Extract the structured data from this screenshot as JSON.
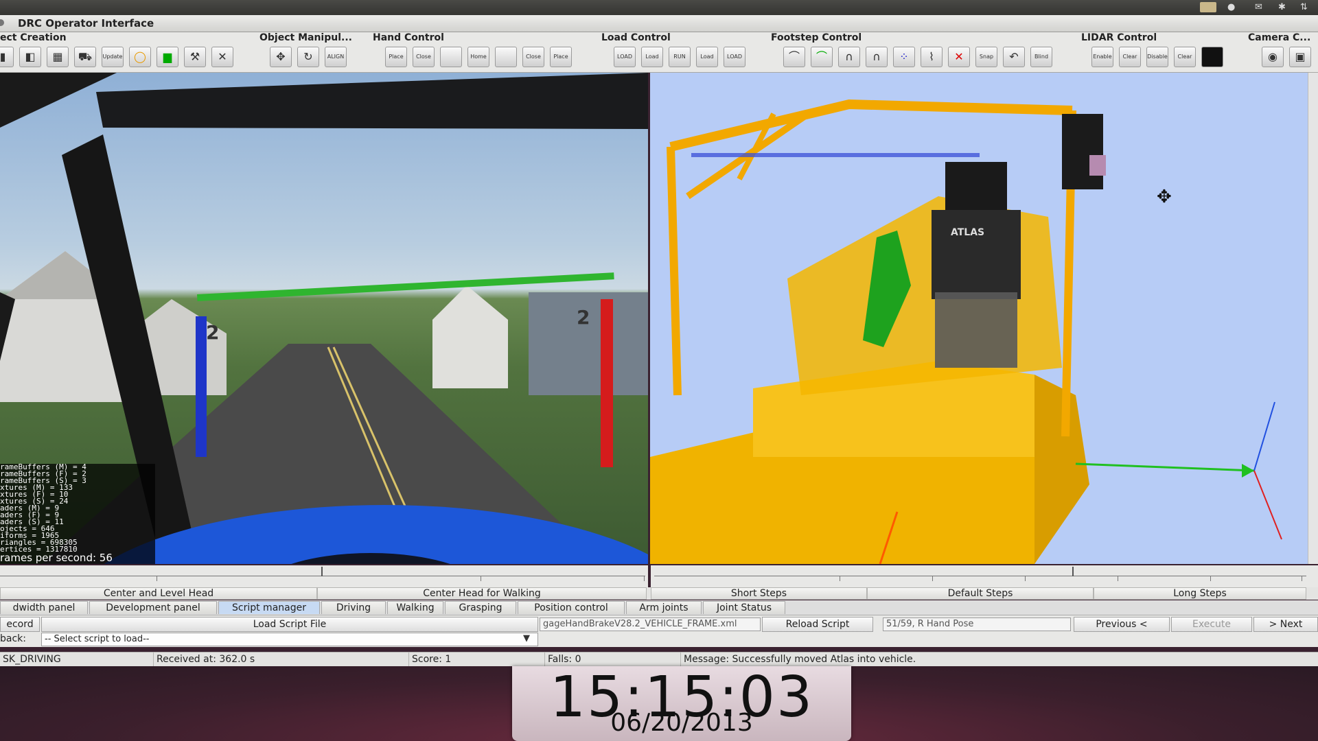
{
  "window": {
    "title": "DRC Operator Interface"
  },
  "toolbar": {
    "groups": [
      {
        "title": "ect Creation"
      },
      {
        "title": "Object Manipul..."
      },
      {
        "title": "Hand Control"
      },
      {
        "title": "Load Control"
      },
      {
        "title": "Footstep Control"
      },
      {
        "title": "LIDAR Control"
      },
      {
        "title": "Camera C..."
      }
    ],
    "icon_labels": {
      "align": "ALIGN",
      "place": "Place",
      "close": "Close",
      "home": "Home",
      "load": "LOAD",
      "load2": "Load",
      "run": "RUN",
      "snap": "Snap",
      "blind": "Blind",
      "enable": "Enable",
      "clear": "Clear",
      "disable": "Disable",
      "update": "Update"
    }
  },
  "left_view": {
    "sign_numbers": [
      "2",
      "2"
    ],
    "stats": [
      "rameBuffers (M) = 4",
      "rameBuffers (F) = 2",
      "rameBuffers (S) = 3",
      "xtures (M) = 133",
      "xtures (F) = 10",
      "xtures (S) = 24",
      "aders (M) = 9",
      "aders (F) = 9",
      "aders (S) = 11",
      "ojects = 646",
      "iforms = 1965",
      "riangles = 698305",
      "ertices = 1317810"
    ],
    "fps": "rames per second: 56"
  },
  "right_view": {
    "robot_label": "ATLAS"
  },
  "head_buttons": {
    "center_level": "Center and Level Head",
    "center_walking": "Center Head for Walking"
  },
  "step_buttons": {
    "short": "Short Steps",
    "default": "Default Steps",
    "long": "Long Steps"
  },
  "tabs": [
    {
      "label": "dwidth panel"
    },
    {
      "label": "Development panel"
    },
    {
      "label": "Script manager"
    },
    {
      "label": "Driving"
    },
    {
      "label": "Walking"
    },
    {
      "label": "Grasping"
    },
    {
      "label": "Position control"
    },
    {
      "label": "Arm joints"
    },
    {
      "label": "Joint Status"
    }
  ],
  "script": {
    "record_label": "ecord",
    "load_script_file": "Load Script File",
    "file_name": "gageHandBrakeV28.2_VEHICLE_FRAME.xml",
    "reload": "Reload Script",
    "step_info": "51/59, R Hand Pose",
    "previous": "Previous <",
    "execute": "Execute",
    "next": "> Next",
    "playback_label": "back:",
    "select_placeholder": "-- Select script to load--"
  },
  "status": {
    "task": "SK_DRIVING",
    "received": "Received at:  362.0 s",
    "score": "Score:  1",
    "falls": "Falls:  0",
    "message": "Message:  Successfully moved Atlas into vehicle."
  },
  "clock": {
    "time": "15:15:03",
    "date": "06/20/2013"
  },
  "colors": {
    "sky": "#b7ccf6",
    "vehicle": "#f5b800",
    "active_tab": "#c7daf3",
    "axis_red": "#e02020",
    "axis_green": "#20c020",
    "axis_blue": "#2050e0"
  }
}
